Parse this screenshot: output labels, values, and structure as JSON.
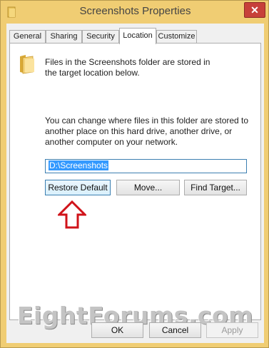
{
  "window": {
    "title": "Screenshots Properties",
    "close_glyph": "✕"
  },
  "tabs": [
    {
      "label": "General"
    },
    {
      "label": "Sharing"
    },
    {
      "label": "Security"
    },
    {
      "label": "Location",
      "active": true
    },
    {
      "label": "Customize"
    }
  ],
  "location_tab": {
    "info_text": "Files in the Screenshots folder are stored in the target location below.",
    "description": "You can change where files in this folder are stored to another place on this hard drive, another drive, or another computer on your network.",
    "path_value": "D:\\Screenshots",
    "buttons": {
      "restore_default": "Restore Default",
      "move": "Move...",
      "find_target": "Find Target..."
    }
  },
  "watermark": "EightForums.com",
  "dialog_buttons": {
    "ok": "OK",
    "cancel": "Cancel",
    "apply": "Apply"
  },
  "icons": {
    "folder": "folder-icon",
    "app": "folder-icon",
    "arrow": "arrow-up-icon",
    "close": "close-icon"
  },
  "colors": {
    "window_frame": "#f0cd73",
    "close_button": "#c7403a",
    "arrow": "#d0131a",
    "selection": "#3399ff"
  }
}
